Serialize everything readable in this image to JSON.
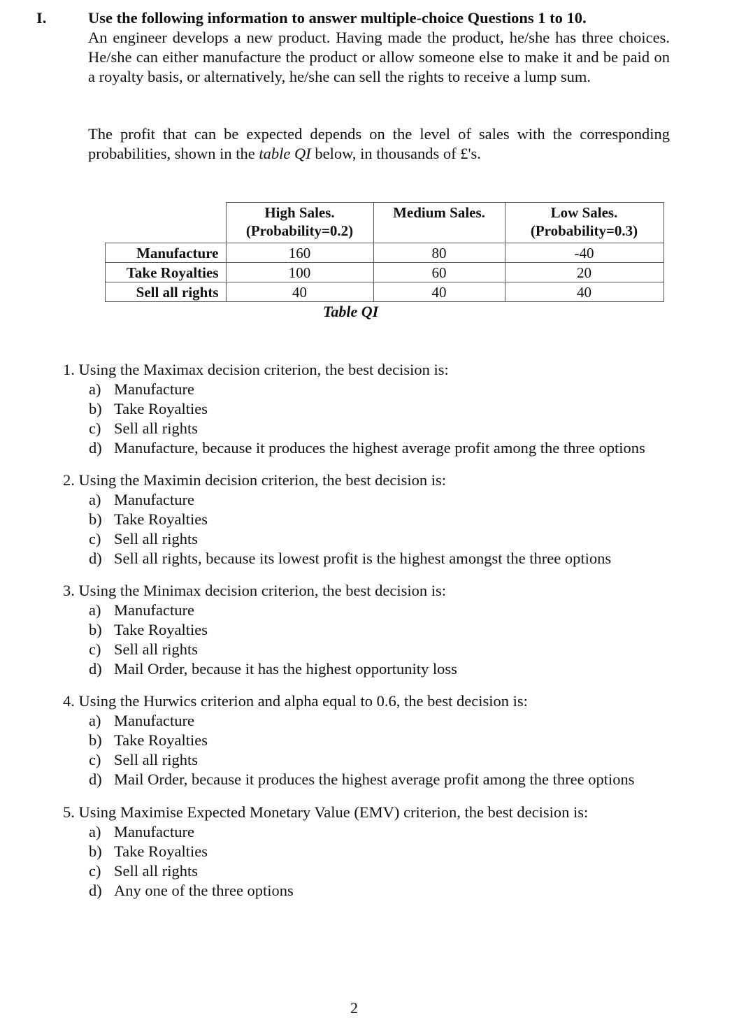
{
  "section": {
    "number": "I.",
    "heading": "Use the following information to answer multiple-choice Questions 1 to 10.",
    "paragraph1": "An engineer develops a new product. Having made the product, he/she has three choices. He/she can either manufacture the product or allow someone else to make it and be paid on a royalty basis, or alternatively, he/she can sell the rights to receive a lump sum.",
    "paragraph2_before": "The profit that can be expected depends on the level of sales with the corresponding probabilities, shown in the ",
    "paragraph2_italic": "table QI",
    "paragraph2_after": " below, in thousands of £'s."
  },
  "table": {
    "caption": "Table QI",
    "headers": [
      {
        "line1": "High Sales.",
        "line2": "(Probability=0.2)"
      },
      {
        "line1": "Medium Sales.",
        "line2": ""
      },
      {
        "line1": "Low Sales.",
        "line2": "(Probability=0.3)"
      }
    ],
    "rows": [
      {
        "label": "Manufacture",
        "values": [
          "160",
          "80",
          "-40"
        ]
      },
      {
        "label": "Take Royalties",
        "values": [
          "100",
          "60",
          "20"
        ]
      },
      {
        "label": "Sell all rights",
        "values": [
          "40",
          "40",
          "40"
        ]
      }
    ]
  },
  "questions": [
    {
      "stem": "1. Using the Maximax decision criterion, the best decision is:",
      "options": [
        {
          "letter": "a)",
          "text": "Manufacture"
        },
        {
          "letter": "b)",
          "text": "Take Royalties"
        },
        {
          "letter": "c)",
          "text": "Sell all rights"
        },
        {
          "letter": "d)",
          "text": "Manufacture, because it produces the highest average profit among the three options"
        }
      ]
    },
    {
      "stem": "2. Using the Maximin decision criterion, the best decision is:",
      "options": [
        {
          "letter": "a)",
          "text": "Manufacture"
        },
        {
          "letter": "b)",
          "text": "Take Royalties"
        },
        {
          "letter": "c)",
          "text": "Sell all rights"
        },
        {
          "letter": "d)",
          "text": "Sell all rights, because its lowest profit is the highest amongst the three options"
        }
      ]
    },
    {
      "stem": "3. Using the Minimax decision criterion, the best decision is:",
      "options": [
        {
          "letter": "a)",
          "text": "Manufacture"
        },
        {
          "letter": "b)",
          "text": "Take Royalties"
        },
        {
          "letter": "c)",
          "text": "Sell all rights"
        },
        {
          "letter": "d)",
          "text": "Mail Order, because it has the highest opportunity loss"
        }
      ]
    },
    {
      "stem": "4. Using the Hurwics criterion and alpha equal to 0.6, the best decision is:",
      "options": [
        {
          "letter": "a)",
          "text": "Manufacture"
        },
        {
          "letter": "b)",
          "text": "Take Royalties"
        },
        {
          "letter": "c)",
          "text": "Sell all rights"
        },
        {
          "letter": "d)",
          "text": "Mail Order, because it produces the highest average profit among the three options"
        }
      ]
    },
    {
      "stem": "5. Using Maximise Expected Monetary Value (EMV) criterion, the best decision is:",
      "options": [
        {
          "letter": "a)",
          "text": "Manufacture"
        },
        {
          "letter": "b)",
          "text": "Take Royalties"
        },
        {
          "letter": "c)",
          "text": "Sell all rights"
        },
        {
          "letter": "d)",
          "text": "Any one of the three options"
        }
      ]
    }
  ],
  "page_number": "2"
}
